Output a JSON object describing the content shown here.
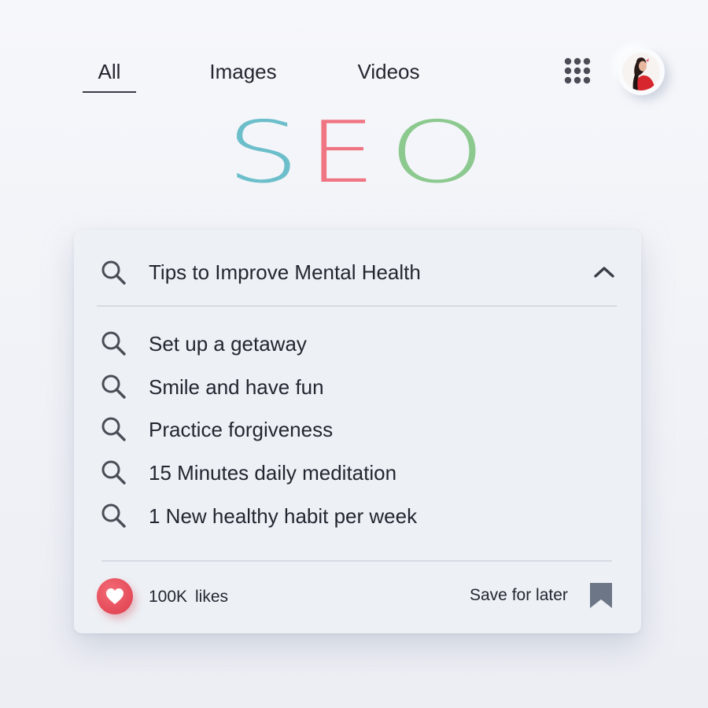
{
  "nav": {
    "tabs": [
      {
        "label": "All",
        "active": true
      },
      {
        "label": "Images",
        "active": false
      },
      {
        "label": "Videos",
        "active": false
      }
    ],
    "apps_icon": "apps-grid-icon",
    "avatar_icon": "user-avatar"
  },
  "logo": {
    "letters": [
      "S",
      "E",
      "O"
    ],
    "colors": [
      "#6cbfca",
      "#f07582",
      "#8cc98f"
    ]
  },
  "search": {
    "query": "Tips to Improve Mental Health",
    "icon": "search-icon",
    "toggle_icon": "chevron-up-icon",
    "suggestions": [
      {
        "label": "Set up a getaway"
      },
      {
        "label": "Smile and have fun"
      },
      {
        "label": "Practice forgiveness"
      },
      {
        "label": "15 Minutes daily meditation"
      },
      {
        "label": "1 New healthy habit per week"
      }
    ]
  },
  "footer": {
    "likes_count": "100K",
    "likes_word": "likes",
    "like_icon": "heart-icon",
    "like_color": "#e44a58",
    "save_label": "Save for later",
    "save_icon": "bookmark-icon"
  }
}
